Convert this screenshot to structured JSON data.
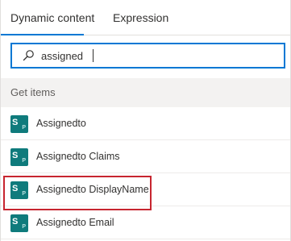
{
  "tabs": [
    {
      "label": "Dynamic content",
      "active": true
    },
    {
      "label": "Expression",
      "active": false
    }
  ],
  "search": {
    "value": "assigned",
    "icon": "search-icon"
  },
  "section": {
    "title": "Get items"
  },
  "items": [
    {
      "label": "Assignedto",
      "icon": "sharepoint-icon"
    },
    {
      "label": "Assignedto Claims",
      "icon": "sharepoint-icon"
    },
    {
      "label": "Assignedto DisplayName",
      "icon": "sharepoint-icon",
      "highlighted": true
    },
    {
      "label": "Assignedto Email",
      "icon": "sharepoint-icon"
    }
  ],
  "colors": {
    "accent": "#0078d4",
    "sharepoint": "#0f7b7c",
    "highlight": "#c7252f"
  }
}
